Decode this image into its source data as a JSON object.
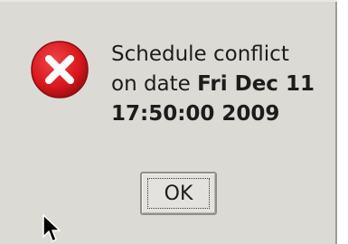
{
  "dialog": {
    "icon": "error-icon",
    "message_line1": "Schedule conflict",
    "message_line2_prefix": "on date ",
    "message_line2_bold": "Fri Dec 11",
    "message_line3_bold": "17:50:00 2009",
    "ok_label": "OK"
  },
  "colors": {
    "dialog_bg": "#dcdad5",
    "error_red": "#d8181c",
    "text": "#1c1c1c"
  },
  "cursor": {
    "icon": "mouse-pointer-icon"
  }
}
